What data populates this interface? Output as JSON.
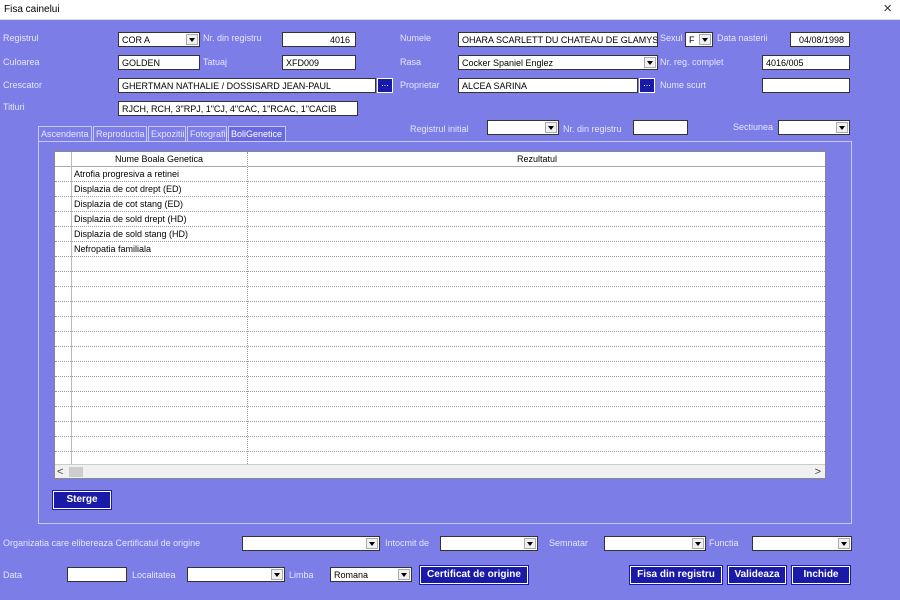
{
  "window": {
    "title": "Fisa cainelui",
    "close_glyph": "×"
  },
  "fields": {
    "registrul": {
      "label": "Registrul",
      "value": "COR A"
    },
    "nr_registru": {
      "label": "Nr. din registru",
      "value": "4016"
    },
    "numele": {
      "label": "Numele",
      "value": "OHARA SCARLETT DU CHATEAU DE GLAMYS"
    },
    "sexul": {
      "label": "Sexul",
      "value": "F"
    },
    "data_nasterii": {
      "label": "Data nasterii",
      "value": "04/08/1998"
    },
    "culoarea": {
      "label": "Culoarea",
      "value": "GOLDEN"
    },
    "tatuaj": {
      "label": "Tatuaj",
      "value": "XFD009"
    },
    "rasa": {
      "label": "Rasa",
      "value": "Cocker Spaniel Englez"
    },
    "nr_reg_complet": {
      "label": "Nr. reg. complet",
      "value": "4016/005"
    },
    "crescator": {
      "label": "Crescator",
      "value": "GHERTMAN NATHALIE / DOSSISARD JEAN-PAUL"
    },
    "proprietar": {
      "label": "Proprietar",
      "value": "ALCEA SARINA"
    },
    "nume_scurt": {
      "label": "Nume scurt",
      "value": ""
    },
    "titluri": {
      "label": "Titluri",
      "value": "RJCH, RCH, 3\"RPJ, 1\"CJ, 4\"CAC, 1\"RCAC, 1\"CACIB"
    },
    "registrul_initial": {
      "label": "Registrul initial",
      "value": ""
    },
    "nr_registru_2": {
      "label": "Nr. din registru",
      "value": ""
    },
    "sectiunea": {
      "label": "Sectiunea",
      "value": ""
    },
    "ellipsis": "..."
  },
  "tabs": [
    "Ascendenta",
    "Reproductia",
    "Expozitii",
    "Fotografii",
    "BoliGenetice"
  ],
  "grid": {
    "headers": [
      "Nume Boala Genetica",
      "Rezultatul"
    ],
    "rows": [
      "Atrofia progresiva a retinei",
      "Displazia de cot drept (ED)",
      "Displazia de cot stang (ED)",
      "Displazia de sold drept (HD)",
      "Displazia de sold stang (HD)",
      "Nefropatia familiala"
    ],
    "scroll_left": "<",
    "scroll_right": ">"
  },
  "buttons": {
    "sterge": "Sterge",
    "certificat": "Certificat de origine",
    "fisa": "Fisa din registru",
    "valideaza": "Valideaza",
    "inchide": "Inchide"
  },
  "bottom": {
    "organizatia": {
      "label": "Organizatia care elibereaza Certificatul de origine",
      "value": ""
    },
    "intocmit": {
      "label": "Intocmit de",
      "value": ""
    },
    "semnatar": {
      "label": "Semnatar",
      "value": ""
    },
    "functia": {
      "label": "Functia",
      "value": ""
    },
    "data": {
      "label": "Data",
      "value": ""
    },
    "localitatea": {
      "label": "Localitatea",
      "value": ""
    },
    "limba": {
      "label": "Limba",
      "value": "Romana"
    }
  }
}
